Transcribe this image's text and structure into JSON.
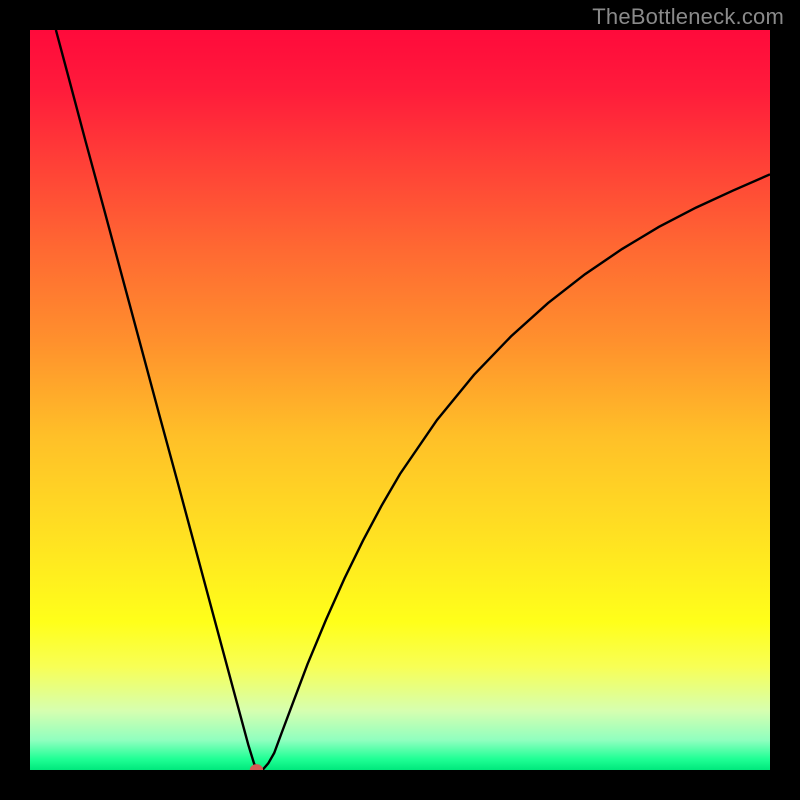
{
  "watermark": "TheBottleneck.com",
  "chart_data": {
    "type": "line",
    "title": "",
    "xlabel": "",
    "ylabel": "",
    "xlim": [
      0,
      100
    ],
    "ylim": [
      0,
      100
    ],
    "grid": false,
    "legend": false,
    "background_gradient": {
      "type": "vertical",
      "stops": [
        {
          "pct": 0.0,
          "color": "#ff0a3b"
        },
        {
          "pct": 0.08,
          "color": "#ff1b3b"
        },
        {
          "pct": 0.18,
          "color": "#ff4037"
        },
        {
          "pct": 0.3,
          "color": "#ff6a32"
        },
        {
          "pct": 0.42,
          "color": "#ff902d"
        },
        {
          "pct": 0.55,
          "color": "#ffc028"
        },
        {
          "pct": 0.68,
          "color": "#ffe022"
        },
        {
          "pct": 0.8,
          "color": "#ffff1a"
        },
        {
          "pct": 0.86,
          "color": "#f8ff55"
        },
        {
          "pct": 0.92,
          "color": "#d6ffb0"
        },
        {
          "pct": 0.96,
          "color": "#8fffbf"
        },
        {
          "pct": 0.985,
          "color": "#20ff95"
        },
        {
          "pct": 1.0,
          "color": "#00e87c"
        }
      ]
    },
    "series": [
      {
        "name": "bottleneck-curve",
        "color": "#000000",
        "lineWidth": 2.4,
        "x": [
          3.5,
          5,
          7.5,
          10,
          12.5,
          15,
          17.5,
          20,
          22.5,
          25,
          27.5,
          29.5,
          30.3,
          31.0,
          31.5,
          32.2,
          33.0,
          34.0,
          35.5,
          37.5,
          40,
          42.5,
          45,
          47.5,
          50,
          55,
          60,
          65,
          70,
          75,
          80,
          85,
          90,
          95,
          100
        ],
        "y": [
          100,
          94.4,
          85.0,
          75.8,
          66.5,
          57.2,
          47.9,
          38.7,
          29.4,
          20.1,
          10.8,
          3.4,
          0.8,
          0.1,
          0.1,
          0.9,
          2.3,
          5.0,
          9.0,
          14.3,
          20.3,
          25.9,
          31.0,
          35.7,
          40.0,
          47.3,
          53.4,
          58.6,
          63.1,
          67.0,
          70.4,
          73.4,
          76.0,
          78.3,
          80.5
        ]
      }
    ],
    "marker": {
      "name": "optimum-point",
      "x": 30.6,
      "y": 0.0,
      "rx": 0.9,
      "ry": 0.8,
      "fill": "#d55a55"
    }
  }
}
